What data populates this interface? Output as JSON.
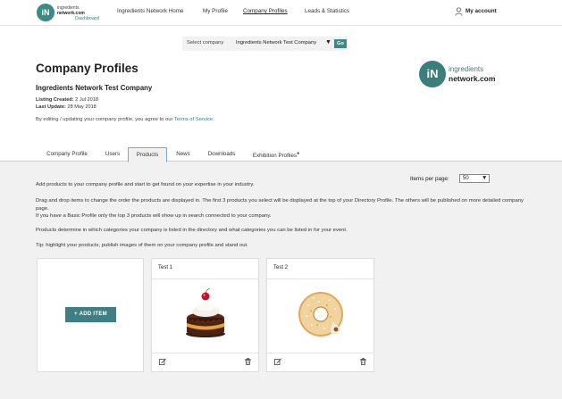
{
  "nav": {
    "logo_line1": "ingredients",
    "logo_line2": "network.com",
    "logo_sub": "Dashboard",
    "logo_mark": "iN",
    "links": [
      "Ingredients Network Home",
      "My Profile",
      "Company Profiles",
      "Leads & Statistics"
    ],
    "account_label": "My account",
    "account_icon": "user-icon"
  },
  "company_select": {
    "label": "Select company",
    "value": "Ingredients Network Test Company",
    "go_label": "Go"
  },
  "header": {
    "title": "Company Profiles",
    "company_name": "Ingredients Network Test Company",
    "listing_created_label": "Listing Created:",
    "listing_created_value": "2 Jul 2018",
    "last_update_label": "Last Update:",
    "last_update_value": "28 May 2018",
    "terms_prefix": "By editing / updating your company profile, you agree to our",
    "terms_link": "Terms of Service",
    "terms_suffix": "."
  },
  "brand_logo": {
    "mark": "iN",
    "line1": "ingredients",
    "line2": "network.com"
  },
  "tabs": [
    "Company Profile",
    "Users",
    "Products",
    "News",
    "Downloads",
    "Exhibition Profiles"
  ],
  "active_tab": "Products",
  "items_per_page": {
    "label": "Items per page:",
    "value": "50"
  },
  "paragraphs": [
    "Add products to your company profile and start to get found on your expertise in your industry.",
    "Drag and drop items to change the order the products are displayed in. The first 3 products you select will be displayed at the top of your Directory Profile. The others will be published on more detailed company page.",
    "If you have a Basic Profile only the top 3 products will show up in search connected to your company.",
    "Products determine in which categories your company is listed in the directory and what categories you can be listed in for your event.",
    "Tip: highlight your products, publish images of them on your company profile and stand out."
  ],
  "add_item_label": "+  ADD ITEM",
  "products": [
    {
      "title": "Test 1",
      "image": "chocolate-cake"
    },
    {
      "title": "Test 2",
      "image": "sugar-donut"
    }
  ],
  "colors": {
    "brand_teal": "#3a8a86",
    "link_blue": "#2e7f9a",
    "page_bg": "#f1f1f1"
  }
}
